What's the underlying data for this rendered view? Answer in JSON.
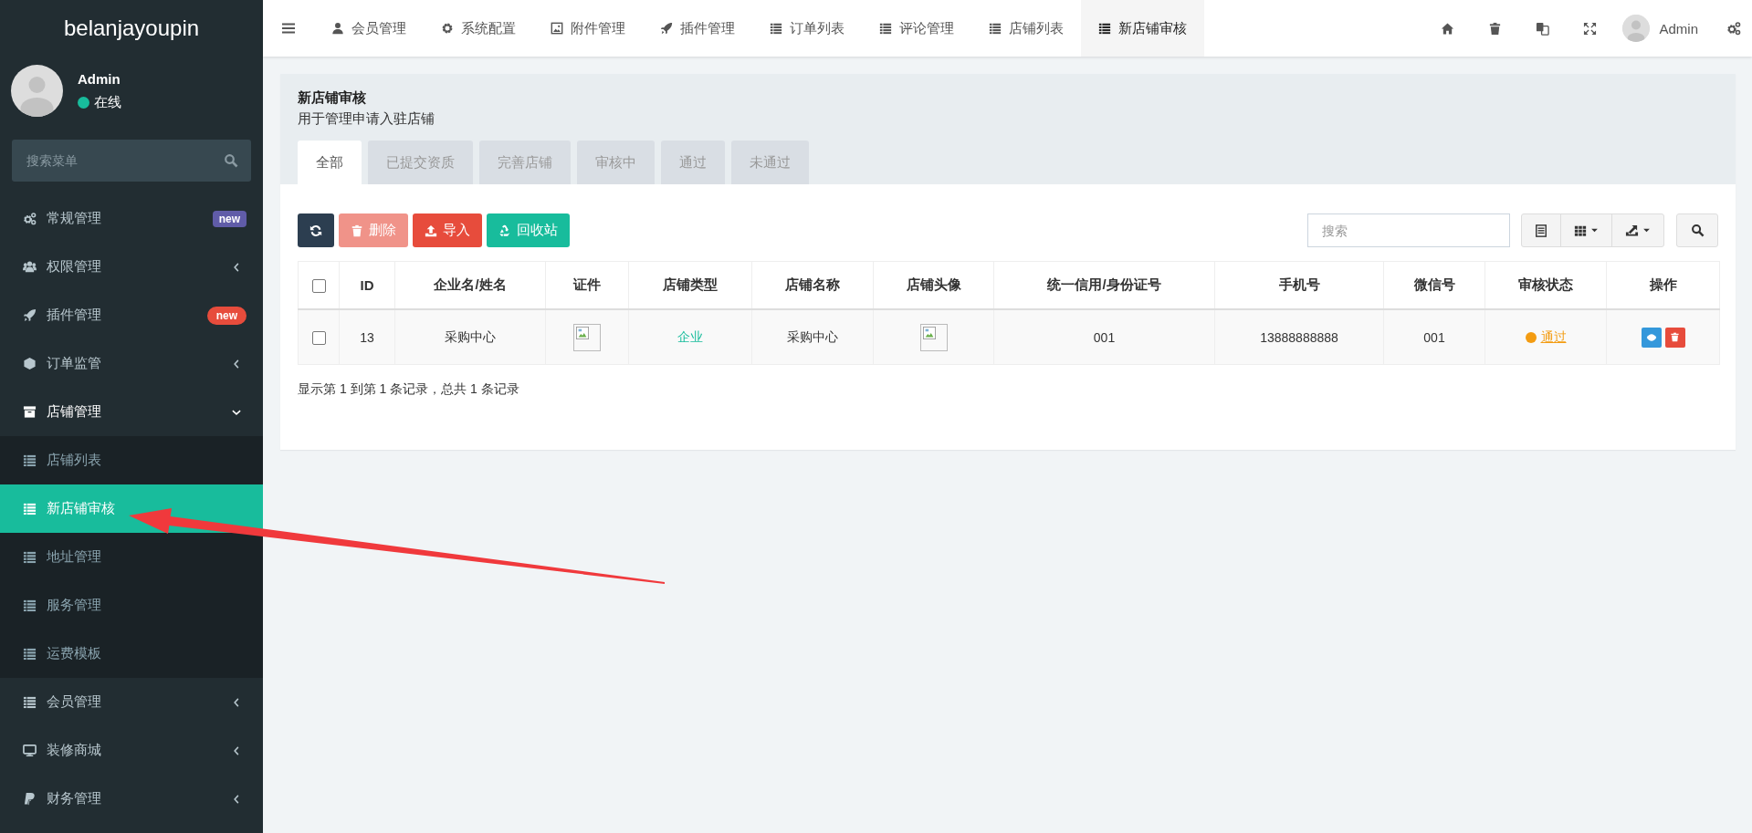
{
  "sidebar": {
    "logo": "belanjayoupin",
    "user": {
      "name": "Admin",
      "status": "在线"
    },
    "search": {
      "placeholder": "搜索菜单"
    },
    "items": [
      {
        "label": "常规管理",
        "badge": {
          "text": "new",
          "color": "#605ca8"
        }
      },
      {
        "label": "权限管理",
        "expanded": false
      },
      {
        "label": "插件管理",
        "badge": {
          "text": "new",
          "color": "#e74c3c"
        }
      },
      {
        "label": "订单监管",
        "expanded": false
      },
      {
        "label": "店铺管理",
        "expanded": true,
        "children": [
          {
            "label": "店铺列表",
            "selected": false
          },
          {
            "label": "新店铺审核",
            "selected": true
          },
          {
            "label": "地址管理",
            "selected": false
          },
          {
            "label": "服务管理",
            "selected": false
          },
          {
            "label": "运费模板",
            "selected": false
          }
        ]
      },
      {
        "label": "会员管理",
        "expanded": false
      },
      {
        "label": "装修商城",
        "expanded": false
      },
      {
        "label": "财务管理",
        "expanded": false
      }
    ]
  },
  "nav": {
    "items": [
      {
        "label": "会员管理",
        "selected": false
      },
      {
        "label": "系统配置",
        "selected": false
      },
      {
        "label": "附件管理",
        "selected": false
      },
      {
        "label": "插件管理",
        "selected": false
      },
      {
        "label": "订单列表",
        "selected": false
      },
      {
        "label": "评论管理",
        "selected": false
      },
      {
        "label": "店铺列表",
        "selected": false
      },
      {
        "label": "新店铺审核",
        "selected": true
      }
    ],
    "user": "Admin"
  },
  "content": {
    "title": "新店铺审核",
    "subtitle": "用于管理申请入驻店铺",
    "tabs": [
      {
        "label": "全部",
        "selected": true
      },
      {
        "label": "已提交资质",
        "selected": false
      },
      {
        "label": "完善店铺",
        "selected": false
      },
      {
        "label": "审核中",
        "selected": false
      },
      {
        "label": "通过",
        "selected": false
      },
      {
        "label": "未通过",
        "selected": false
      }
    ],
    "toolbar": {
      "buttons": [
        {
          "kind": "refresh",
          "disabled": false
        },
        {
          "kind": "delete",
          "label": "删除",
          "disabled": true
        },
        {
          "kind": "import",
          "label": "导入",
          "disabled": false
        },
        {
          "kind": "recycle",
          "label": "回收站",
          "disabled": false
        }
      ],
      "search": {
        "placeholder": "搜索"
      }
    },
    "table": {
      "columns": [
        {
          "kind": "checkbox",
          "checked": false
        },
        {
          "kind": "text",
          "label": "ID"
        },
        {
          "kind": "text",
          "label": "企业名/姓名"
        },
        {
          "kind": "text",
          "label": "证件"
        },
        {
          "kind": "text",
          "label": "店铺类型"
        },
        {
          "kind": "text",
          "label": "店铺名称"
        },
        {
          "kind": "text",
          "label": "店铺头像"
        },
        {
          "kind": "text",
          "label": "统一信用/身份证号"
        },
        {
          "kind": "text",
          "label": "手机号"
        },
        {
          "kind": "text",
          "label": "微信号"
        },
        {
          "kind": "text",
          "label": "审核状态"
        },
        {
          "kind": "text",
          "label": "操作"
        }
      ],
      "rows": [
        {
          "cells": [
            {
              "kind": "checkbox",
              "checked": false
            },
            {
              "kind": "text",
              "text": "13"
            },
            {
              "kind": "text",
              "text": "采购中心"
            },
            {
              "kind": "image"
            },
            {
              "kind": "link",
              "text": "企业"
            },
            {
              "kind": "text",
              "text": "采购中心"
            },
            {
              "kind": "image"
            },
            {
              "kind": "text",
              "text": "001"
            },
            {
              "kind": "text",
              "text": "13888888888"
            },
            {
              "kind": "text",
              "text": "001"
            },
            {
              "kind": "status",
              "text": "通过",
              "color": "#f39c12"
            },
            {
              "kind": "actions",
              "buttons": [
                {
                  "kind": "view"
                },
                {
                  "kind": "delete"
                }
              ]
            }
          ]
        }
      ]
    },
    "footer": "显示第 1 到第 1 条记录，总共 1 条记录"
  }
}
